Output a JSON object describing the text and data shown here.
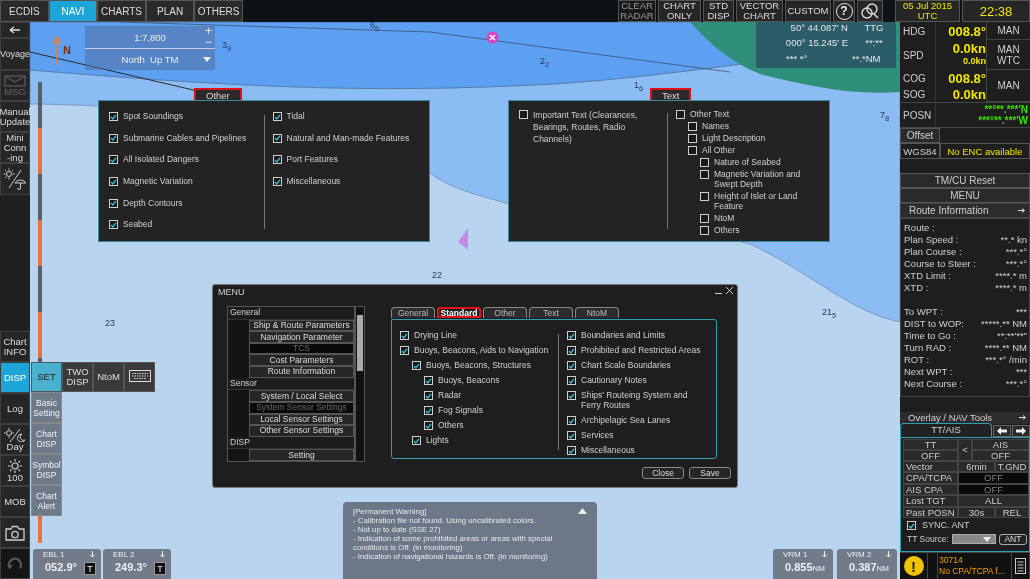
{
  "top_bar": {
    "tabs": [
      {
        "label": "ECDIS",
        "selected": false
      },
      {
        "label": "NAVI",
        "selected": true
      },
      {
        "label": "CHARTS",
        "selected": false
      },
      {
        "label": "PLAN",
        "selected": false
      },
      {
        "label": "OTHERS",
        "selected": false
      }
    ],
    "buttons": [
      {
        "label": "CLEAR RADAR",
        "disabled": true
      },
      {
        "label": "CHART ONLY",
        "disabled": false
      },
      {
        "label": "STD DISP",
        "disabled": false
      },
      {
        "label": "VECTOR CHART",
        "disabled": false
      },
      {
        "label": "CUSTOM",
        "disabled": false
      }
    ],
    "help": "?",
    "date": "05 Jul 2015",
    "timezone": "UTC",
    "time": "22:38"
  },
  "left_bar": {
    "upper": [
      {
        "label": "Voyage",
        "disabled": false
      },
      {
        "label": "MSG",
        "disabled": true
      },
      {
        "label": "Manual Update",
        "disabled": false
      },
      {
        "label": "Mini Conn -ing",
        "disabled": false
      }
    ],
    "chart_info": "Chart INFO",
    "modes": [
      {
        "label": "DISP",
        "selected": true,
        "expanded": false
      },
      {
        "label": "SET",
        "selected": false,
        "expanded": true
      },
      {
        "label": "TWO DISP",
        "selected": false,
        "expanded": false
      },
      {
        "label": "NtoM",
        "selected": false,
        "expanded": false
      }
    ],
    "submenu": [
      "Basic Setting",
      "Chart DISP",
      "Symbol DISP",
      "Chart Alert"
    ],
    "lower": [
      "Log",
      "Day",
      "100",
      "MOB"
    ]
  },
  "map": {
    "scale": "1:7,800",
    "zoom_in": "+",
    "zoom_out": "−",
    "orientation": "North  Up TM",
    "north_label": "N",
    "soundings": [
      "3$_{9}$",
      "6$_{6}$",
      "2$_{2}$",
      "1$_{6}$",
      "7$_{8}$",
      "23",
      "22",
      "21$_{5}$"
    ],
    "cursor": {
      "lat": "50° 44.087' N",
      "lon": "000° 15.245' E",
      "bearing": "*** *°",
      "ttg_label": "TTG",
      "ttg": "**:**",
      "distance": "**.*NM"
    }
  },
  "other_popup": {
    "title": "Other",
    "highlighted": true,
    "columns": [
      [
        {
          "label": "Spot Soundings",
          "checked": true
        },
        {
          "label": "Submarine Cables and Pipelines",
          "checked": true
        },
        {
          "label": "All Isolated Dangers",
          "checked": true
        },
        {
          "label": "Magnetic Variation",
          "checked": true
        },
        {
          "label": "Depth Contours",
          "checked": true
        },
        {
          "label": "Seabed",
          "checked": true
        }
      ],
      [
        {
          "label": "Tidal",
          "checked": true
        },
        {
          "label": "Natural and Man-made Features",
          "checked": true
        },
        {
          "label": "Port Features",
          "checked": true
        },
        {
          "label": "Miscellaneous",
          "checked": true
        }
      ]
    ]
  },
  "text_popup": {
    "title": "Text",
    "highlighted": true,
    "columns": [
      [
        {
          "label": "Important Text (Clearances, Bearings, Routes, Radio Channels)",
          "checked": false
        }
      ],
      [
        {
          "label": "Other Text",
          "checked": false,
          "children": [
            {
              "label": "Names",
              "checked": false
            },
            {
              "label": "Light Description",
              "checked": false
            },
            {
              "label": "All Other",
              "checked": false,
              "children": [
                {
                  "label": "Nature of Seabed",
                  "checked": false
                },
                {
                  "label": "Magnetic Variation and Swept Depth",
                  "checked": false
                },
                {
                  "label": "Height of Islet or Land Feature",
                  "checked": false
                },
                {
                  "label": "NtoM",
                  "checked": false
                },
                {
                  "label": "Others",
                  "checked": false
                }
              ]
            }
          ]
        }
      ]
    ]
  },
  "menu_dialog": {
    "title": "MENU",
    "tree": [
      {
        "label": "General",
        "children": [
          {
            "label": "Ship & Route Parameters",
            "disabled": false
          },
          {
            "label": "Navigation Parameter",
            "disabled": false
          },
          {
            "label": "TCS",
            "disabled": true
          },
          {
            "label": "Cost Parameters",
            "disabled": false
          },
          {
            "label": "Route Information",
            "disabled": false
          }
        ]
      },
      {
        "label": "Sensor",
        "children": [
          {
            "label": "System / Local Select",
            "disabled": false
          },
          {
            "label": "System Sensor Settings",
            "disabled": true
          },
          {
            "label": "Local Sensor Settings",
            "disabled": false
          },
          {
            "label": "Other Sensor Settings",
            "disabled": false
          }
        ]
      },
      {
        "label": "DISP",
        "children": [
          {
            "label": "Setting",
            "disabled": false
          }
        ]
      }
    ],
    "tabs": [
      {
        "label": "General",
        "selected": false,
        "highlighted": false
      },
      {
        "label": "Standard",
        "selected": true,
        "highlighted": true
      },
      {
        "label": "Other",
        "selected": false,
        "highlighted": false
      },
      {
        "label": "Text",
        "selected": false,
        "highlighted": false
      },
      {
        "label": "NtoM",
        "selected": false,
        "highlighted": false
      }
    ],
    "columns": [
      [
        {
          "label": "Drying Line",
          "checked": true
        },
        {
          "label": "Buoys, Beacons, Aids to Navigation",
          "checked": true,
          "children": [
            {
              "label": "Buoys, Beacons, Structures",
              "checked": true,
              "children": [
                {
                  "label": "Buoys, Beacons",
                  "checked": true
                },
                {
                  "label": "Radar",
                  "checked": true
                },
                {
                  "label": "Fog Signals",
                  "checked": true
                },
                {
                  "label": "Others",
                  "checked": true
                }
              ]
            },
            {
              "label": "Lights",
              "checked": true
            }
          ]
        }
      ],
      [
        {
          "label": "Boundaries and Limits",
          "checked": true
        },
        {
          "label": "Prohibited and Restricted Areas",
          "checked": true
        },
        {
          "label": "Chart Scale Boundaries",
          "checked": true
        },
        {
          "label": "Cautionary Notes",
          "checked": true
        },
        {
          "label": "Ships' Routeing System and Ferry Routes",
          "checked": true
        },
        {
          "label": "Archipelagic Sea Lanes",
          "checked": true
        },
        {
          "label": "Services",
          "checked": true
        },
        {
          "label": "Miscellaneous",
          "checked": true
        }
      ]
    ],
    "buttons": [
      "Close",
      "Save"
    ]
  },
  "warning": {
    "title": "[Permanent Warning]",
    "lines": [
      "- Calibration file not found. Using uncalibrated colors.",
      "- Not up to date (SSE 27)",
      "- Indication of some prohibited areas or areas with special conditions is Off. (in monitoring)",
      "- Indication of navigational hazards is Off. (in monitoring)"
    ]
  },
  "ebl": [
    {
      "label": "EBL 1",
      "value": "052.9°",
      "mode": "T"
    },
    {
      "label": "EBL 2",
      "value": "249.3°",
      "mode": "T"
    }
  ],
  "vrm": [
    {
      "label": "VRM 1",
      "value": "0.855",
      "unit": "NM"
    },
    {
      "label": "VRM 2",
      "value": "0.387",
      "unit": "NM"
    }
  ],
  "nav": {
    "rows": [
      {
        "label": "HDG",
        "value": "008.8°"
      },
      {
        "label": "SPD",
        "value": "0.0kn",
        "sub_value": "0.0kn"
      },
      {
        "label": "COG",
        "value": "008.8°"
      },
      {
        "label": "SOG",
        "value": "0.0kn"
      }
    ],
    "modes": [
      "MAN",
      "MAN WTC",
      "MAN"
    ],
    "posn": {
      "label": "POSN",
      "lat": "**°**.***'N",
      "lon": "***°**.***'W"
    },
    "offset": "Offset",
    "datum": "WGS84",
    "enc_status": "No ENC available",
    "buttons": [
      "TM/CU Reset",
      "MENU"
    ]
  },
  "route_info": {
    "title": "Route Information",
    "groups": [
      [
        {
          "label": "Route :"
        },
        {
          "label": "Plan Speed :",
          "value": "**.* kn"
        },
        {
          "label": "Plan Course :",
          "value": "***.*°"
        },
        {
          "label": "Course to Steer :",
          "value": "***.*°"
        },
        {
          "label": "XTD Limit :",
          "value": "****.* m"
        },
        {
          "label": "XTD :",
          "value": "****.* m"
        }
      ],
      [
        {
          "label": "To WPT :",
          "value": "***"
        },
        {
          "label": "DIST to WOP:",
          "value": "*****.** NM"
        },
        {
          "label": "Time to Go :",
          "value": "**:**'**\""
        },
        {
          "label": "Turn RAD :",
          "value": "****.** NM"
        },
        {
          "label": "ROT :",
          "value": "***.*° /min"
        },
        {
          "label": "Next WPT :",
          "value": "***"
        },
        {
          "label": "Next Course :",
          "value": "***.*°"
        }
      ]
    ]
  },
  "overlay": {
    "title": "Overlay / NAV Tools",
    "tab": "TT/AIS",
    "tt": {
      "label": "TT",
      "value": "OFF"
    },
    "swap": "<",
    "ais": {
      "label": "AIS",
      "value": "OFF"
    },
    "rows": [
      {
        "label": "Vector",
        "values": [
          "6min",
          "T.GND"
        ],
        "disabled": false
      },
      {
        "label": "CPA/TCPA",
        "values": [
          "OFF"
        ],
        "disabled": true
      },
      {
        "label": "AIS CPA",
        "values": [
          "OFF"
        ],
        "disabled": true
      },
      {
        "label": "Lost TGT",
        "values": [
          "ALL"
        ],
        "disabled": false
      },
      {
        "label": "Past POSN",
        "values": [
          "30s",
          "REL"
        ],
        "disabled": false
      }
    ],
    "sync": {
      "label": "SYNC. ANT",
      "checked": true
    },
    "source_label": "TT Source:",
    "source_button": "ANT"
  },
  "alert": {
    "icon": "!",
    "code": "30714",
    "message": "No CPA/TCPA f..."
  }
}
